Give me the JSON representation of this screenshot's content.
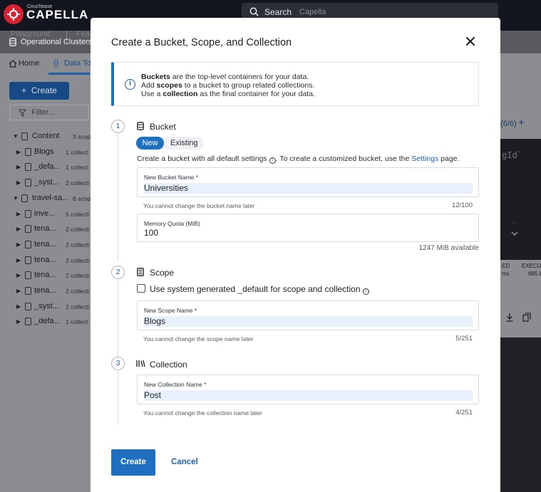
{
  "app": {
    "brand_small": "Couchbase",
    "brand": "CAPELLA",
    "search_label": "Search",
    "search_scope": "Capella"
  },
  "secondary_bar": {
    "faded_left": "Playground",
    "faded_right": "Fea",
    "current": "Operational Clusters"
  },
  "nav": {
    "home": "Home",
    "data_tools": "Data Too"
  },
  "sidebar": {
    "create_label": "Create",
    "filter_placeholder": "Filter...",
    "tree": [
      {
        "name": "Content",
        "count": "3 scop",
        "level": 0,
        "expanded": true
      },
      {
        "name": "Blogs",
        "count": "1 collect",
        "level": 1
      },
      {
        "name": "_defa...",
        "count": "1 collect",
        "level": 1
      },
      {
        "name": "_syst...",
        "count": "2 collecti",
        "level": 1
      },
      {
        "name": "travel-sa...",
        "count": "8 scop",
        "level": 0,
        "expanded": true
      },
      {
        "name": "inve...",
        "count": "5 collecti",
        "level": 1
      },
      {
        "name": "tena...",
        "count": "2 collecti",
        "level": 1
      },
      {
        "name": "tena...",
        "count": "2 collecti",
        "level": 1
      },
      {
        "name": "tena...",
        "count": "2 collecti",
        "level": 1
      },
      {
        "name": "tena...",
        "count": "2 collecti",
        "level": 1
      },
      {
        "name": "tena...",
        "count": "2 collecti",
        "level": 1
      },
      {
        "name": "_syst...",
        "count": "2 collecti",
        "level": 1
      },
      {
        "name": "_defa...",
        "count": "1 collect",
        "level": 1
      }
    ]
  },
  "right_panel": {
    "counter": "(6/6)",
    "add": "+",
    "code_text": "gId`",
    "col1_header": "ED",
    "col1_value": "ms",
    "col2_header": "EXECUT",
    "col2_value": "685.8"
  },
  "modal": {
    "title": "Create a Bucket, Scope, and Collection",
    "info_icon": "i",
    "info": {
      "line1_bold": "Buckets",
      "line1_rest": " are the top-level containers for your data.",
      "line2_pre": "Add ",
      "line2_bold": "scopes",
      "line2_rest": " to a bucket to group related collections.",
      "line3_pre": "Use a ",
      "line3_bold": "collection",
      "line3_rest": " as the final container for your data."
    },
    "bucket": {
      "step": "1",
      "title": "Bucket",
      "toggle_new": "New",
      "toggle_existing": "Existing",
      "desc_pre": "Create a bucket with all default settings ",
      "desc_info": "i",
      "desc_mid": ". To create a customized bucket, use the ",
      "desc_link": "Settings",
      "desc_post": " page.",
      "name_label": "New Bucket Name *",
      "name_value": "Universities",
      "name_helper": "You cannot change the bucket name later",
      "name_counter": "12/100",
      "quota_label": "Memory Quota (MiB)",
      "quota_value": "100",
      "quota_available": "1247 MiB available"
    },
    "scope": {
      "step": "2",
      "title": "Scope",
      "checkbox_label": "Use system generated _default for scope and collection",
      "checkbox_info": "i",
      "checked": false,
      "name_label": "New Scope Name *",
      "name_value": "Blogs",
      "name_helper": "You cannot change the scope name later",
      "name_counter": "5/251"
    },
    "collection": {
      "step": "3",
      "title": "Collection",
      "name_label": "New Collection Name *",
      "name_value": "Post",
      "name_helper": "You cannot change the collection name later",
      "name_counter": "4/251"
    },
    "create_button": "Create",
    "cancel_button": "Cancel"
  },
  "colors": {
    "primary": "#1f6fc1",
    "link": "#1f5fa8",
    "brand_red": "#d8202f",
    "overlay_gray": "#8c8d91"
  }
}
